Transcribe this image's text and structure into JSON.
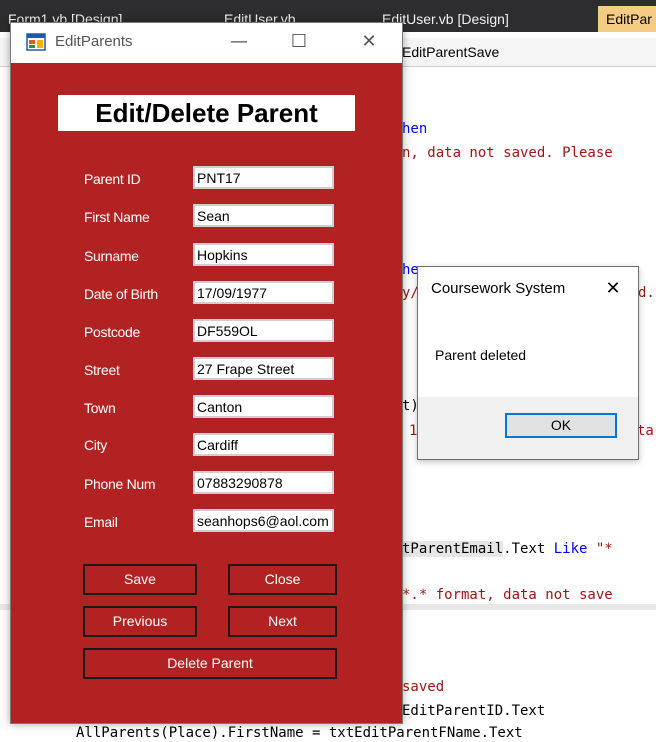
{
  "ide": {
    "tabs": [
      "Form1.vb [Design]",
      "EditUser.vb",
      "EditUser.vb [Design]",
      "EditPar"
    ],
    "member_dropdown": "EditParentSave",
    "code_lines": [
      "hen",
      "n, data not saved. Please",
      "he",
      "y/",
      "d.",
      "t)",
      "1",
      "ta",
      "tParentEmail",
      ".Text ",
      "Like",
      " \"*",
      "*.* format, data not save",
      "saved",
      "EditParentID.Text",
      "AllParents(Place).FirstName = txtEditParentFName.Text"
    ]
  },
  "form": {
    "title": "EditParents",
    "heading": "Edit/Delete Parent",
    "controls": {
      "minimize": "—",
      "maximize": "☐",
      "close": "✕"
    },
    "fields": [
      {
        "label": "Parent ID",
        "value": "PNT17"
      },
      {
        "label": "First Name",
        "value": "Sean"
      },
      {
        "label": "Surname",
        "value": "Hopkins"
      },
      {
        "label": "Date of Birth",
        "value": "17/09/1977"
      },
      {
        "label": "Postcode",
        "value": "DF559OL"
      },
      {
        "label": "Street",
        "value": "27 Frape Street"
      },
      {
        "label": "Town",
        "value": "Canton"
      },
      {
        "label": "City",
        "value": "Cardiff"
      },
      {
        "label": "Phone Num",
        "value": "07883290878"
      },
      {
        "label": "Email",
        "value": "seanhops6@aol.com"
      }
    ],
    "buttons": {
      "save": "Save",
      "close": "Close",
      "previous": "Previous",
      "next": "Next",
      "delete": "Delete Parent"
    }
  },
  "messagebox": {
    "title": "Coursework System",
    "close": "✕",
    "message": "Parent deleted",
    "ok": "OK"
  },
  "colors": {
    "form_background": "#b22222",
    "ide_tab_bar": "#2d2d30",
    "active_tab": "#f5cc84",
    "code_keyword": "#0000ff",
    "code_string": "#a31515"
  }
}
